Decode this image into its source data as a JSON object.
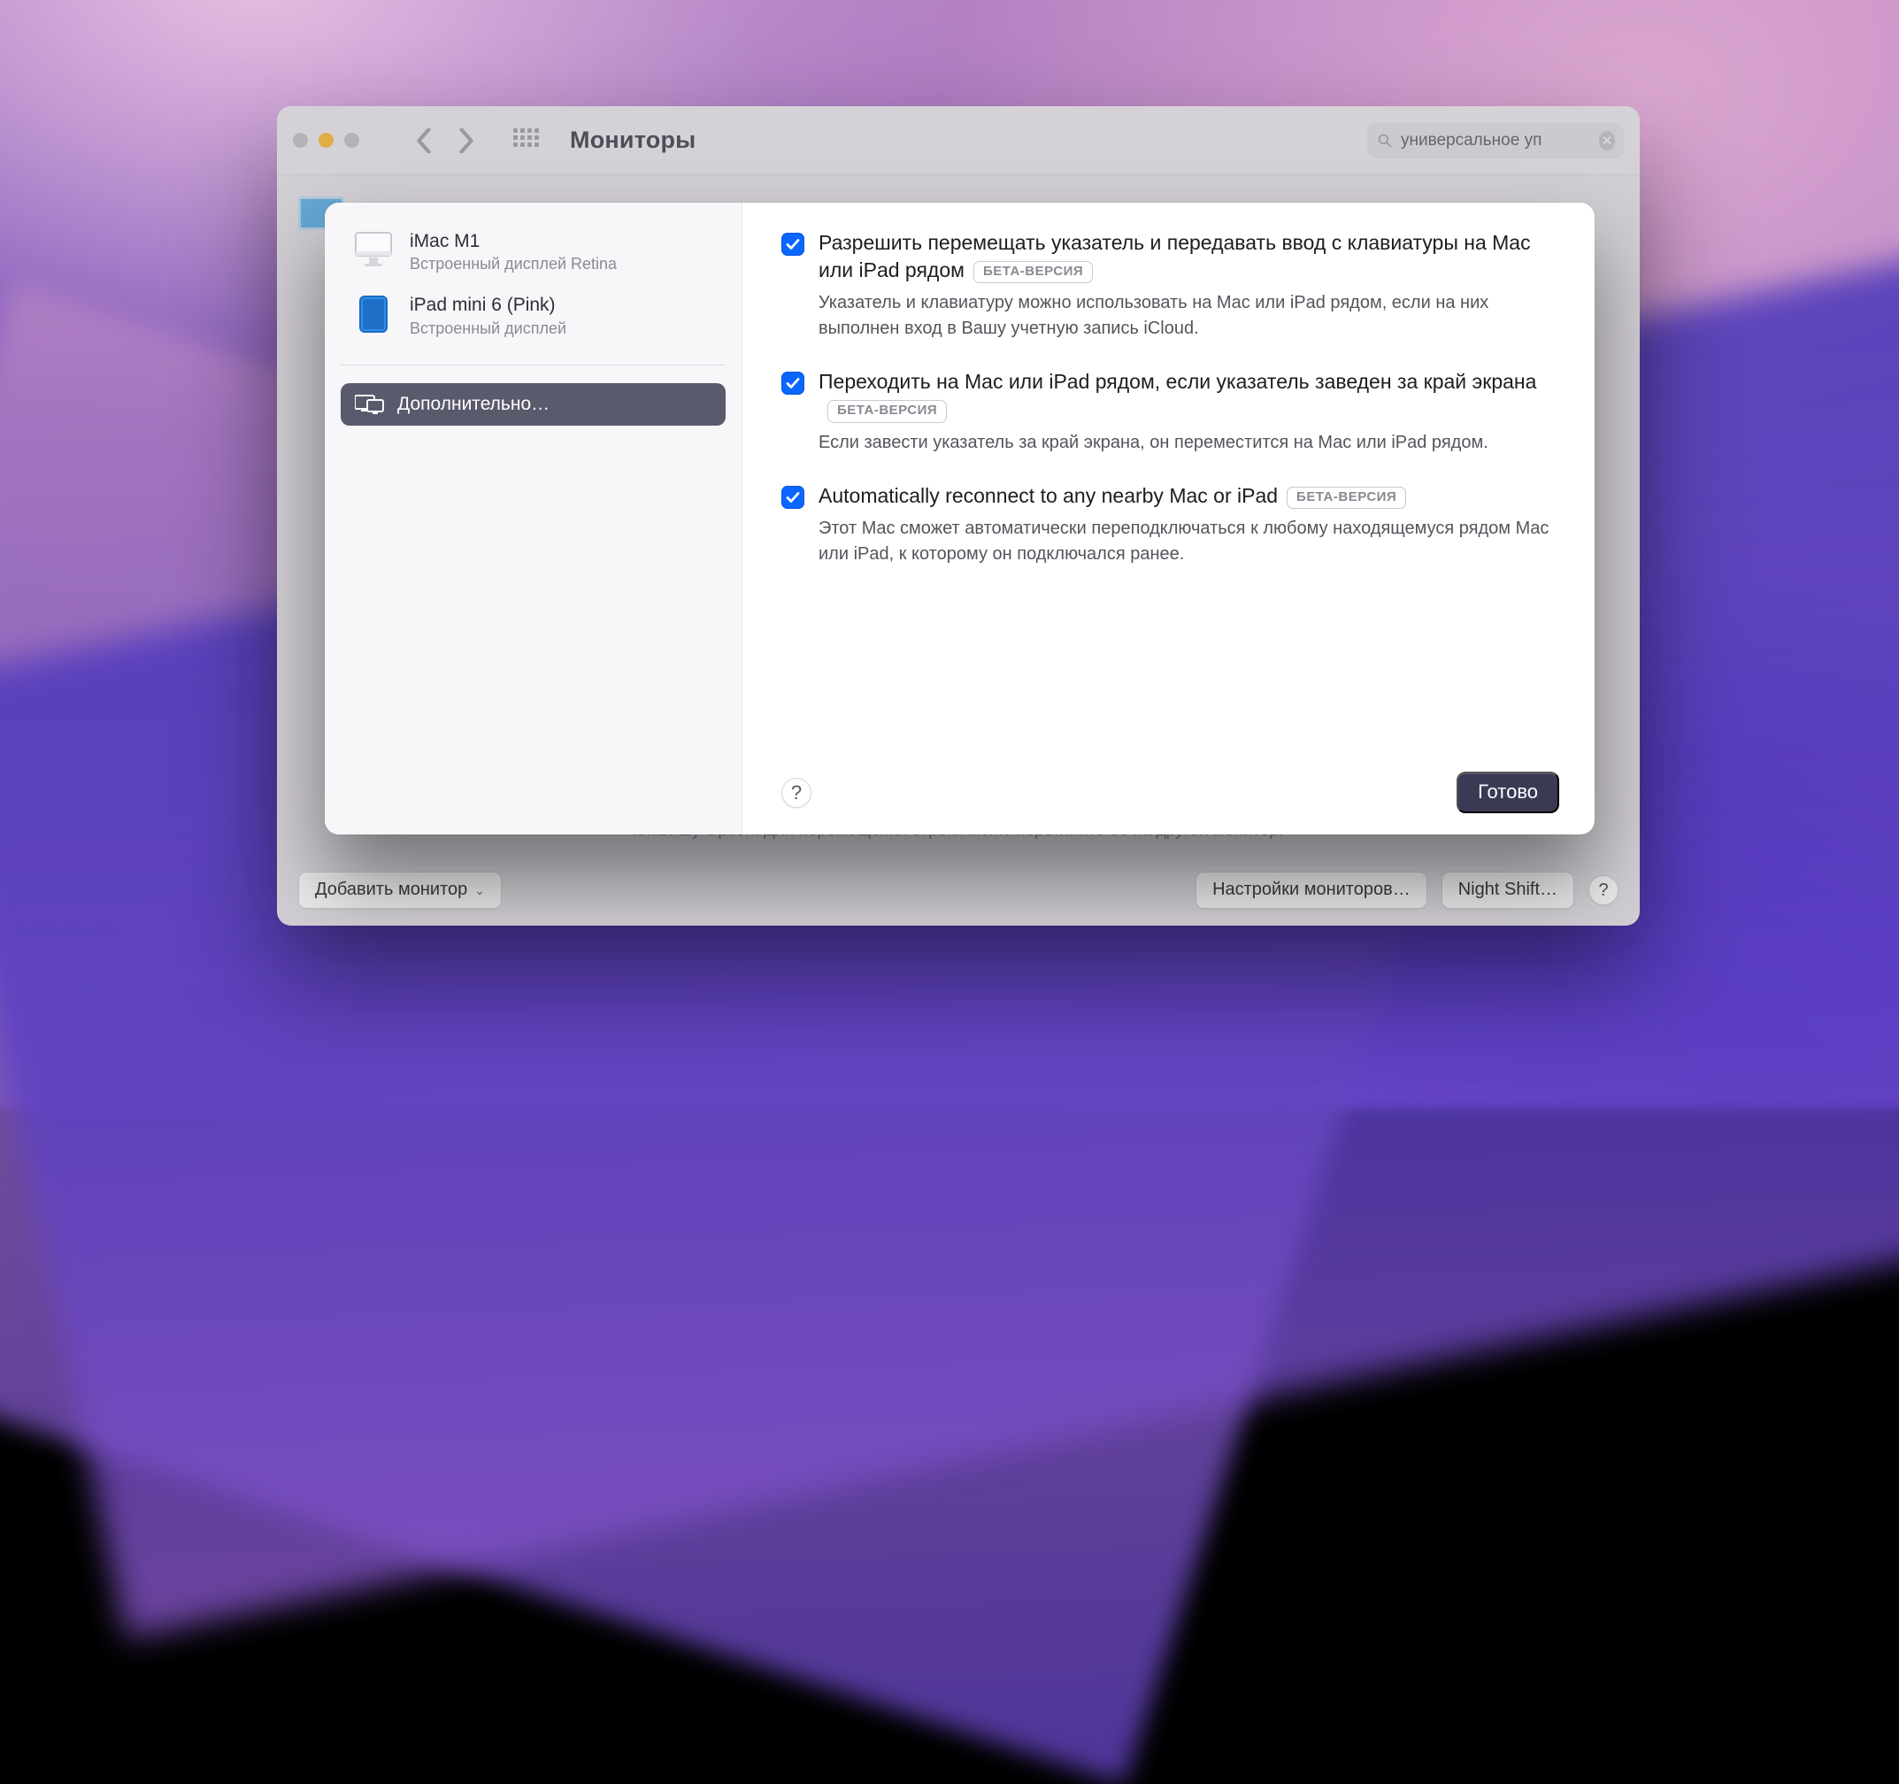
{
  "toolbar": {
    "title": "Мониторы",
    "search_value": "универсальное уп"
  },
  "background_hint": "клавишу Option. Для перемещения строки меню перетяните ее на другой монитор.",
  "bottom": {
    "add_display": "Добавить монитор",
    "display_settings": "Настройки мониторов…",
    "night_shift": "Night Shift…"
  },
  "sidebar": {
    "devices": [
      {
        "name": "iMac M1",
        "subtitle": "Встроенный дисплей Retina"
      },
      {
        "name": "iPad mini 6 (Pink)",
        "subtitle": "Встроенный дисплей"
      }
    ],
    "advanced": "Дополнительно…"
  },
  "options": [
    {
      "checked": true,
      "title": "Разрешить перемещать указатель и передавать ввод с клавиатуры на Mac или iPad рядом",
      "beta": "БЕТА-ВЕРСИЯ",
      "description": "Указатель и клавиатуру можно использовать на Mac или iPad рядом, если на них выполнен вход в Вашу учетную запись iCloud."
    },
    {
      "checked": true,
      "title": "Переходить на Mac или iPad рядом, если указатель заведен за край экрана",
      "beta": "БЕТА-ВЕРСИЯ",
      "description": "Если завести указатель за край экрана, он переместится на Mac или iPad рядом."
    },
    {
      "checked": true,
      "title": "Automatically reconnect to any nearby Mac or iPad",
      "beta": "БЕТА-ВЕРСИЯ",
      "description": "Этот Mac сможет автоматически переподключаться к любому находящемуся рядом Mac или iPad, к которому он подключался ранее."
    }
  ],
  "modal": {
    "done": "Готово",
    "help": "?"
  }
}
